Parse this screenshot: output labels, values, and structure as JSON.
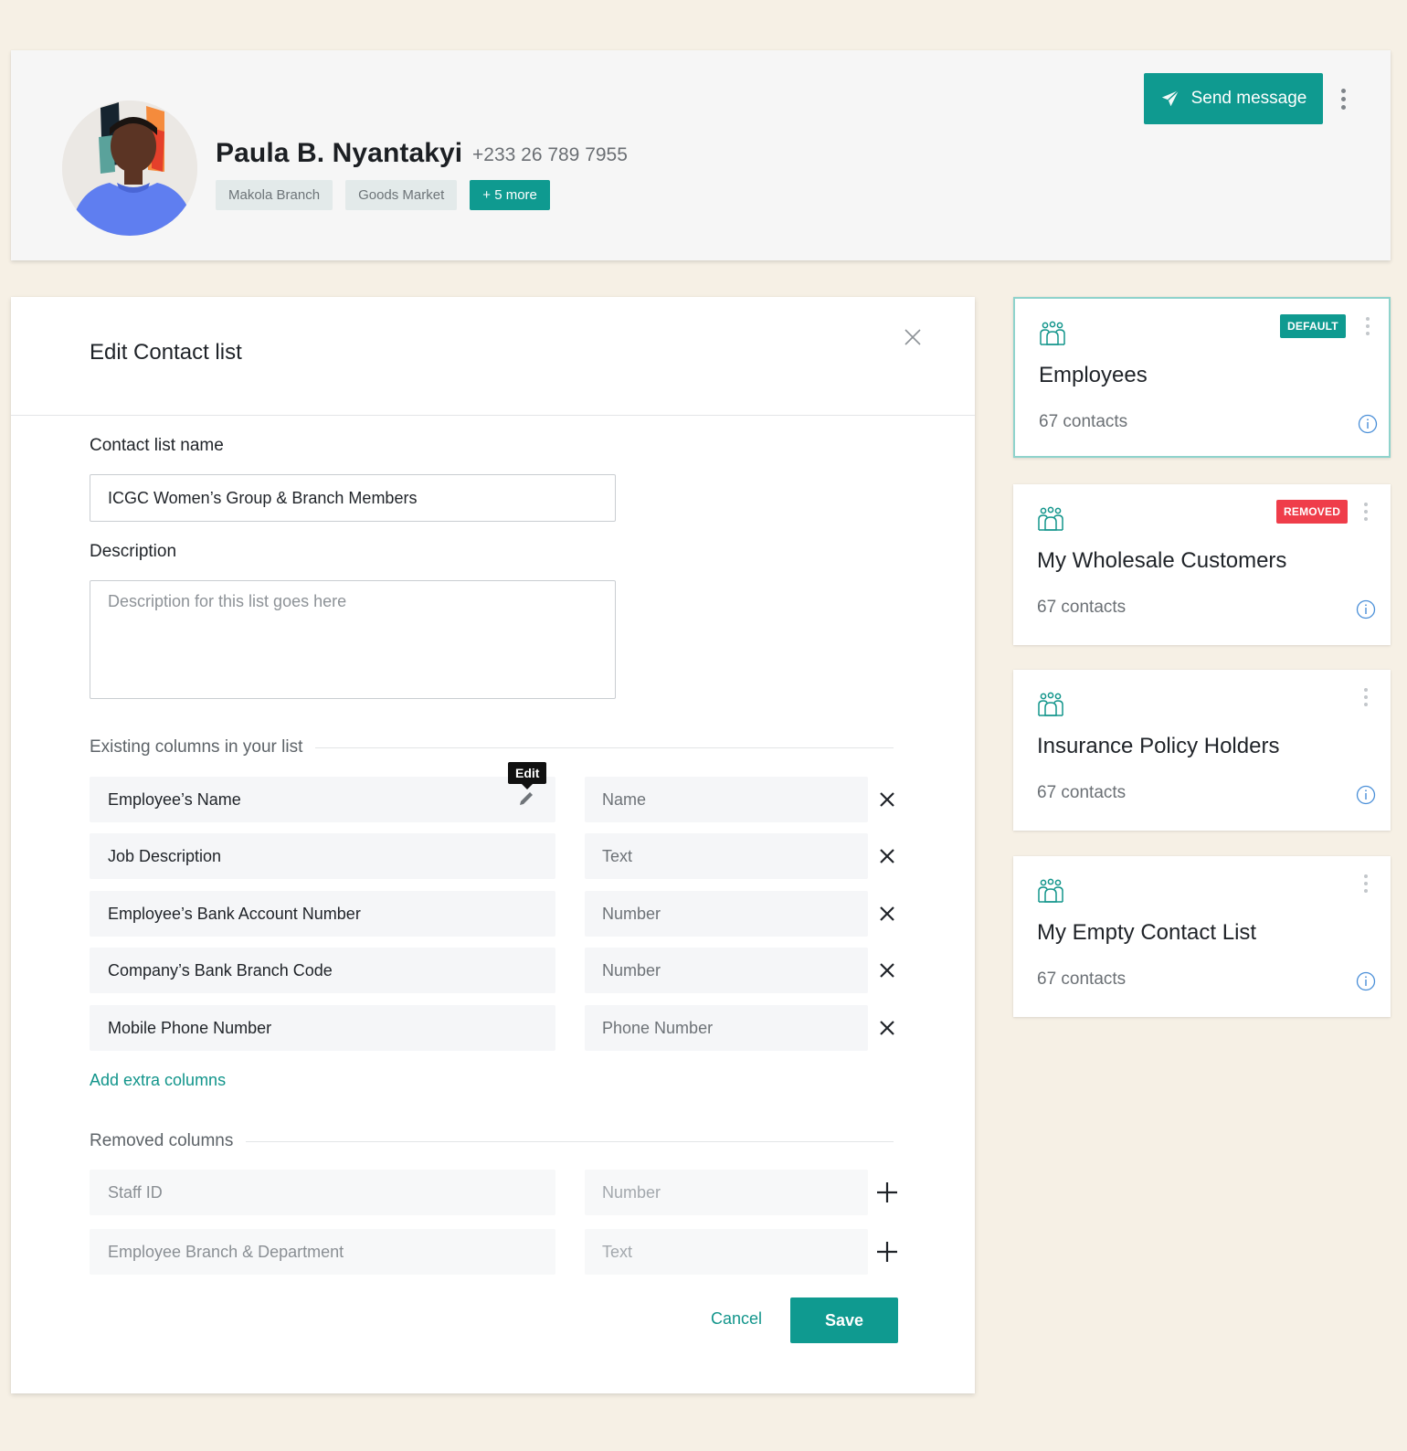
{
  "profile": {
    "name": "Paula B. Nyantakyi",
    "phone": "+233 26 789 7955",
    "tags": [
      "Makola Branch",
      "Goods Market"
    ],
    "more_tag": "+ 5 more",
    "send_button": "Send message"
  },
  "modal": {
    "title": "Edit Contact list",
    "name_label": "Contact list name",
    "name_value": "ICGC Women’s Group & Branch Members",
    "description_label": "Description",
    "description_placeholder": "Description for this list goes here",
    "existing_heading": "Existing columns in your list",
    "tooltip": "Edit",
    "existing_columns": [
      {
        "name": "Employee’s Name",
        "type": "Name"
      },
      {
        "name": "Job Description",
        "type": "Text"
      },
      {
        "name": "Employee’s Bank Account Number",
        "type": "Number"
      },
      {
        "name": "Company’s Bank Branch Code",
        "type": "Number"
      },
      {
        "name": "Mobile Phone Number",
        "type": "Phone Number"
      }
    ],
    "add_columns": "Add extra columns",
    "removed_heading": "Removed columns",
    "removed_columns": [
      {
        "name": "Staff ID",
        "type": "Number"
      },
      {
        "name": "Employee Branch & Department",
        "type": "Text"
      }
    ],
    "cancel": "Cancel",
    "save": "Save"
  },
  "lists": [
    {
      "title": "Employees",
      "count": "67 contacts",
      "badge": "DEFAULT"
    },
    {
      "title": "My Wholesale Customers",
      "count": "67 contacts",
      "badge": "REMOVED"
    },
    {
      "title": "Insurance Policy Holders",
      "count": "67 contacts"
    },
    {
      "title": "My Empty Contact List",
      "count": "67 contacts"
    }
  ],
  "colors": {
    "accent": "#0f9a90",
    "removed_badge": "#ef3d4a",
    "background": "#f6f0e5"
  }
}
